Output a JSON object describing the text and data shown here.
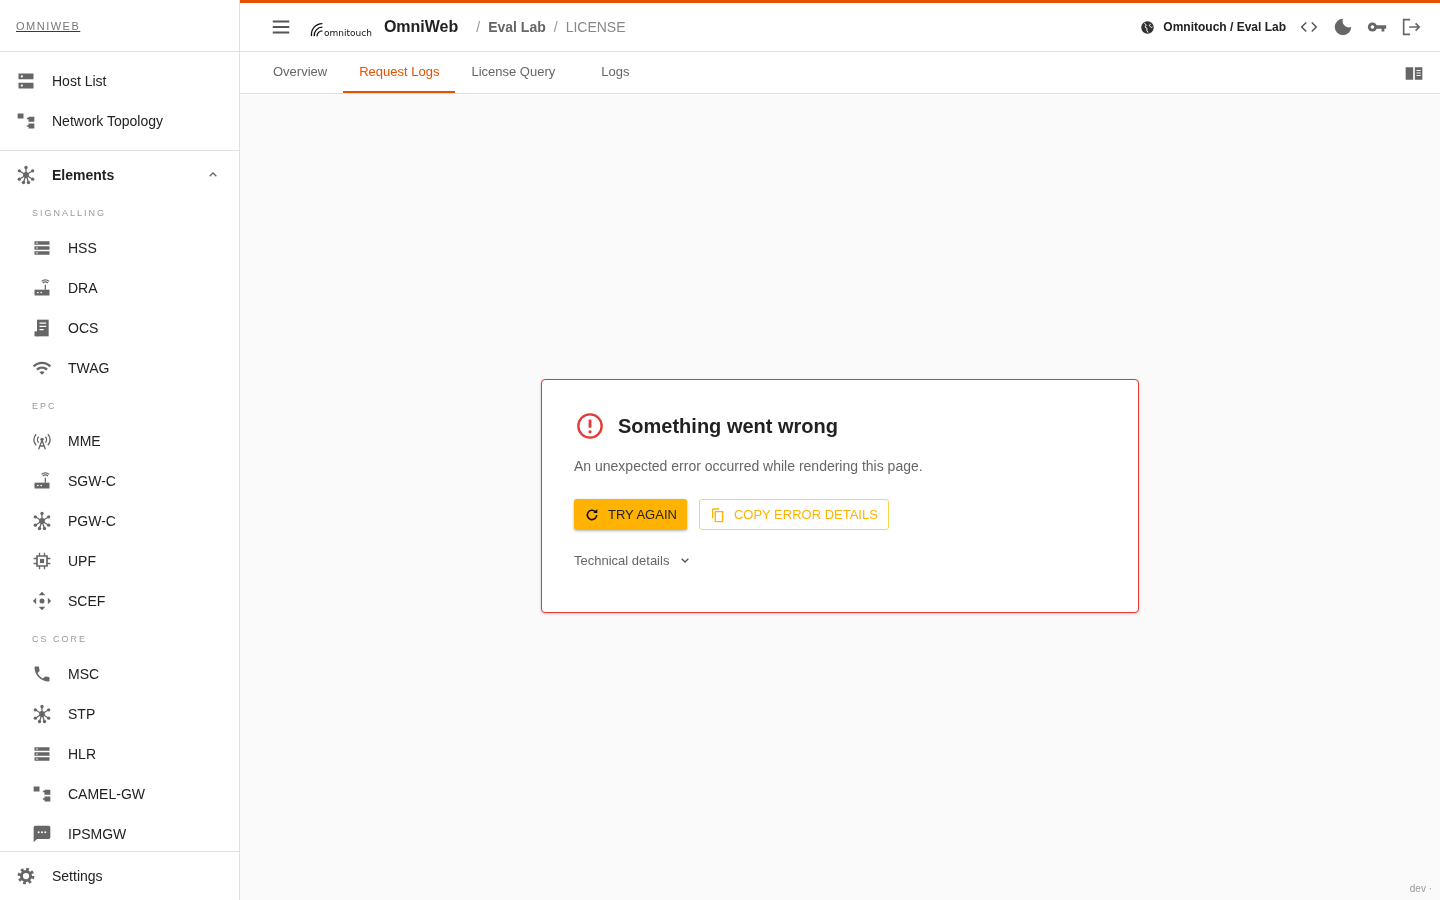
{
  "sidebar": {
    "brand": "OMNIWEB",
    "top_items": [
      {
        "label": "Host List",
        "kind": "server"
      },
      {
        "label": "Network Topology",
        "kind": "tree"
      }
    ],
    "group": {
      "label": "Elements",
      "kind": "hub",
      "expanded": true
    },
    "sections": [
      {
        "heading": "SIGNALLING",
        "items": [
          {
            "label": "HSS",
            "kind": "stack"
          },
          {
            "label": "DRA",
            "kind": "router"
          },
          {
            "label": "OCS",
            "kind": "receipt"
          },
          {
            "label": "TWAG",
            "kind": "wifi"
          }
        ]
      },
      {
        "heading": "EPC",
        "items": [
          {
            "label": "MME",
            "kind": "antenna"
          },
          {
            "label": "SGW-C",
            "kind": "router"
          },
          {
            "label": "PGW-C",
            "kind": "hub"
          },
          {
            "label": "UPF",
            "kind": "chip"
          },
          {
            "label": "SCEF",
            "kind": "move"
          }
        ]
      },
      {
        "heading": "CS CORE",
        "items": [
          {
            "label": "MSC",
            "kind": "phone"
          },
          {
            "label": "STP",
            "kind": "hub"
          },
          {
            "label": "HLR",
            "kind": "stack"
          },
          {
            "label": "CAMEL-GW",
            "kind": "tree"
          },
          {
            "label": "IPSMGW",
            "kind": "chat"
          }
        ]
      }
    ],
    "footer": {
      "label": "Settings",
      "kind": "gear"
    }
  },
  "header": {
    "logo_text": "omnitouch",
    "app_name": "OmniWeb",
    "breadcrumbs": [
      {
        "separator": "/",
        "label": "Eval Lab"
      },
      {
        "separator": "/",
        "label": "LICENSE"
      }
    ],
    "tenant": "Omnitouch / Eval Lab"
  },
  "tabs": [
    {
      "label": "Overview",
      "selected": false
    },
    {
      "label": "Request Logs",
      "selected": true
    },
    {
      "label": "License Query",
      "selected": false
    },
    {
      "label": "Logs",
      "selected": false
    }
  ],
  "error_card": {
    "title": "Something went wrong",
    "message": "An unexpected error occurred while rendering this page.",
    "buttons": [
      {
        "label": "TRY AGAIN",
        "kind": "primary"
      },
      {
        "label": "COPY ERROR DETAILS",
        "kind": "outline"
      }
    ],
    "details": {
      "label": "Technical details",
      "expanded": false
    }
  },
  "footer_note": "dev ·"
}
